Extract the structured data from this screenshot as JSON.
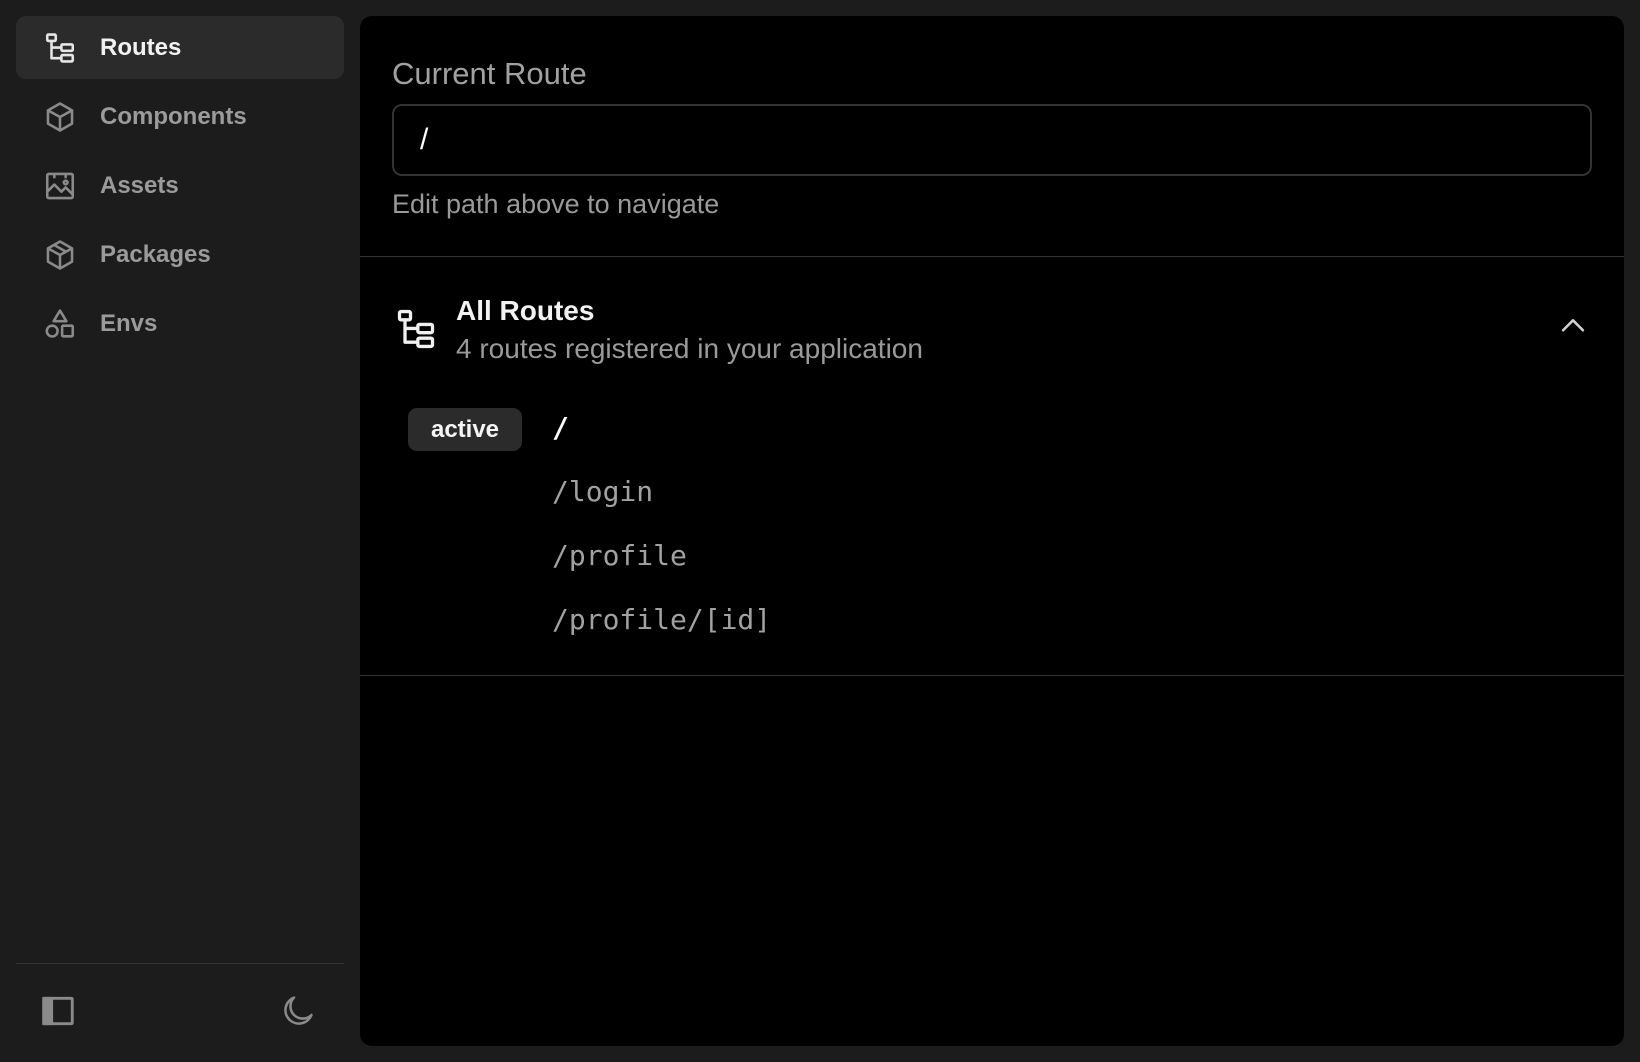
{
  "sidebar": {
    "items": [
      {
        "label": "Routes",
        "icon": "routes-tree-icon",
        "active": true
      },
      {
        "label": "Components",
        "icon": "box-icon"
      },
      {
        "label": "Assets",
        "icon": "image-icon"
      },
      {
        "label": "Packages",
        "icon": "package-icon"
      },
      {
        "label": "Envs",
        "icon": "shapes-icon"
      }
    ],
    "footer": {
      "left_icon": "sidebar-toggle-icon",
      "right_icon": "moon-icon"
    }
  },
  "current_route": {
    "label": "Current Route",
    "value": "/",
    "hint": "Edit path above to navigate"
  },
  "all_routes": {
    "title": "All Routes",
    "subtitle": "4 routes registered in your application",
    "active_badge": "active",
    "routes": [
      {
        "path": "/",
        "active": true
      },
      {
        "path": "/login"
      },
      {
        "path": "/profile"
      },
      {
        "path": "/profile/[id]"
      }
    ]
  },
  "colors": {
    "background": "#1c1c1c",
    "panel": "#000000",
    "active_nav": "#2b2b2b",
    "muted_text": "#9a9a9a",
    "border": "#333333"
  }
}
